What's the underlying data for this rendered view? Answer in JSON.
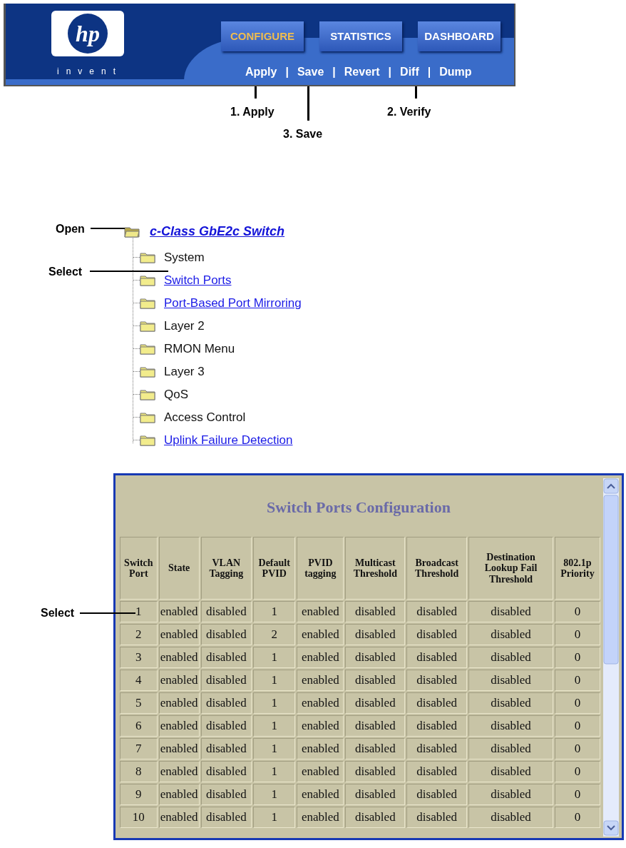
{
  "header": {
    "logo": {
      "mark": "hp",
      "tagline": "invent"
    },
    "tabs": [
      {
        "label": "CONFIGURE",
        "selected": true
      },
      {
        "label": "STATISTICS",
        "selected": false
      },
      {
        "label": "DASHBOARD",
        "selected": false
      }
    ],
    "actions": [
      "Apply",
      "Save",
      "Revert",
      "Diff",
      "Dump"
    ],
    "separators": [
      "|",
      "|",
      "|",
      "|"
    ]
  },
  "header_callouts": [
    "1. Apply",
    "3. Save",
    "2. Verify"
  ],
  "tree": {
    "label": "c-Class GbE2c Switch",
    "expanded": true,
    "link": true,
    "children": [
      {
        "label": "System",
        "link": false
      },
      {
        "label": "Switch Ports",
        "link": true
      },
      {
        "label": "Port-Based Port Mirroring",
        "link": true
      },
      {
        "label": "Layer 2",
        "link": false
      },
      {
        "label": "RMON Menu",
        "link": false
      },
      {
        "label": "Layer 3",
        "link": false
      },
      {
        "label": "QoS",
        "link": false
      },
      {
        "label": "Access Control",
        "link": false
      },
      {
        "label": "Uplink Failure Detection",
        "link": true
      }
    ]
  },
  "tree_callouts": [
    "Open",
    "Select"
  ],
  "table_callout": "Select",
  "table": {
    "title": "Switch Ports Configuration",
    "columns": [
      "Switch Port",
      "State",
      "VLAN Tagging",
      "Default PVID",
      "PVID tagging",
      "Multicast Threshold",
      "Broadcast Threshold",
      "Destination Lookup Fail Threshold",
      "802.1p Priority"
    ],
    "rows": [
      [
        "1",
        "enabled",
        "disabled",
        "1",
        "enabled",
        "disabled",
        "disabled",
        "disabled",
        "0"
      ],
      [
        "2",
        "enabled",
        "disabled",
        "2",
        "enabled",
        "disabled",
        "disabled",
        "disabled",
        "0"
      ],
      [
        "3",
        "enabled",
        "disabled",
        "1",
        "enabled",
        "disabled",
        "disabled",
        "disabled",
        "0"
      ],
      [
        "4",
        "enabled",
        "disabled",
        "1",
        "enabled",
        "disabled",
        "disabled",
        "disabled",
        "0"
      ],
      [
        "5",
        "enabled",
        "disabled",
        "1",
        "enabled",
        "disabled",
        "disabled",
        "disabled",
        "0"
      ],
      [
        "6",
        "enabled",
        "disabled",
        "1",
        "enabled",
        "disabled",
        "disabled",
        "disabled",
        "0"
      ],
      [
        "7",
        "enabled",
        "disabled",
        "1",
        "enabled",
        "disabled",
        "disabled",
        "disabled",
        "0"
      ],
      [
        "8",
        "enabled",
        "disabled",
        "1",
        "enabled",
        "disabled",
        "disabled",
        "disabled",
        "0"
      ],
      [
        "9",
        "enabled",
        "disabled",
        "1",
        "enabled",
        "disabled",
        "disabled",
        "disabled",
        "0"
      ],
      [
        "10",
        "enabled",
        "disabled",
        "1",
        "enabled",
        "disabled",
        "disabled",
        "disabled",
        "0"
      ]
    ]
  }
}
